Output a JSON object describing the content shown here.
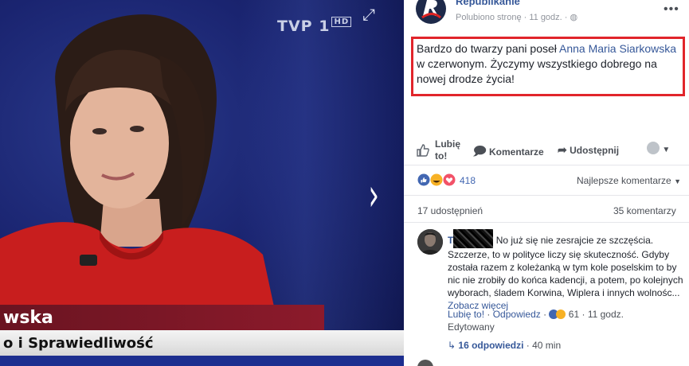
{
  "photo": {
    "channel": "TVP",
    "channel_num": "1",
    "channel_hd": "HD",
    "caption_name": "wska",
    "caption_party": "o i Sprawiedliwość"
  },
  "post": {
    "page_name": "Republikanie",
    "meta_text": "Polubiono stronę",
    "time": "11 godz.",
    "text_before": "Bardzo do twarzy pani poseł ",
    "mention": "Anna Maria Siarkowska",
    "text_after": " w czerwonym. Życzymy wszystkiego dobrego na nowej drodze życia!"
  },
  "actions": {
    "like": "Lubię to!",
    "comment": "Komentarze",
    "share": "Udostępnij"
  },
  "stats": {
    "reactions_count": "418",
    "sort_label": "Najlepsze komentarze",
    "shares": "17 udostępnień",
    "comments": "35 komentarzy"
  },
  "comment": {
    "author_initial": "T",
    "text": "No już się nie zesrajcie ze szczęścia. Szczerze, to w polityce liczy się skuteczność. Gdyby została razem z koleżanką w tym kole poselskim to by nic nie zrobiły do końca kadencji, a potem, po kolejnych wyborach, śladem Korwina, Wiplera i innych wolnośc...",
    "see_more": "Zobacz więcej",
    "like": "Lubię to!",
    "reply": "Odpowiedz",
    "reaction_count": "61",
    "time": "11 godz.",
    "edited": "Edytowany",
    "replies": "16 odpowiedzi",
    "replies_time": "40 min"
  },
  "colors": {
    "link": "#365899",
    "highlight": "#e1252b",
    "blue_reaction": "#4267b2"
  }
}
